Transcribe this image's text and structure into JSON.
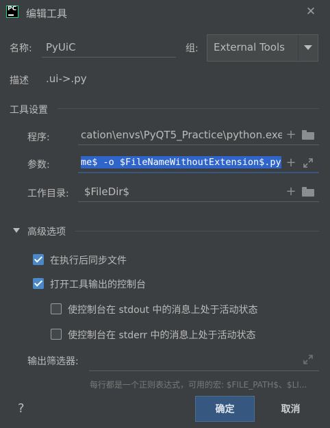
{
  "window": {
    "app_icon_text": "PC",
    "title": "编辑工具",
    "close_glyph": "✕"
  },
  "form": {
    "name_label": "名称:",
    "name_value": "PyUiC",
    "group_label": "组:",
    "group_value": "External Tools",
    "description_label": "描述",
    "description_value": ".ui->.py"
  },
  "tool_settings": {
    "section_title": "工具设置",
    "program_label": "程序:",
    "program_value": "cation\\envs\\PyQT5_Practice\\python.exe",
    "arguments_label": "参数:",
    "arguments_value": "me$ -o $FileNameWithoutExtension$.py",
    "workdir_label": "工作目录:",
    "workdir_value": "$FileDir$"
  },
  "advanced": {
    "section_title": "高级选项",
    "sync_files_label": "在执行后同步文件",
    "sync_files_checked": true,
    "open_console_label": "打开工具输出的控制台",
    "open_console_checked": true,
    "stdout_active_label": "使控制台在 stdout 中的消息上处于活动状态",
    "stdout_active_checked": false,
    "stderr_active_label": "使控制台在 stderr 中的消息上处于活动状态",
    "stderr_active_checked": false,
    "output_filters_label": "输出筛选器:",
    "output_filters_value": "",
    "filters_hint": "每行都是一个正则表达式，可用的宏: $FILE_PATH$、$LI..."
  },
  "footer": {
    "help_glyph": "?",
    "ok_label": "确定",
    "cancel_label": "取消"
  },
  "colors": {
    "background": "#3c3f41",
    "accent": "#365880",
    "selection": "#2f65ca",
    "checkbox_on": "#4a88c7"
  }
}
